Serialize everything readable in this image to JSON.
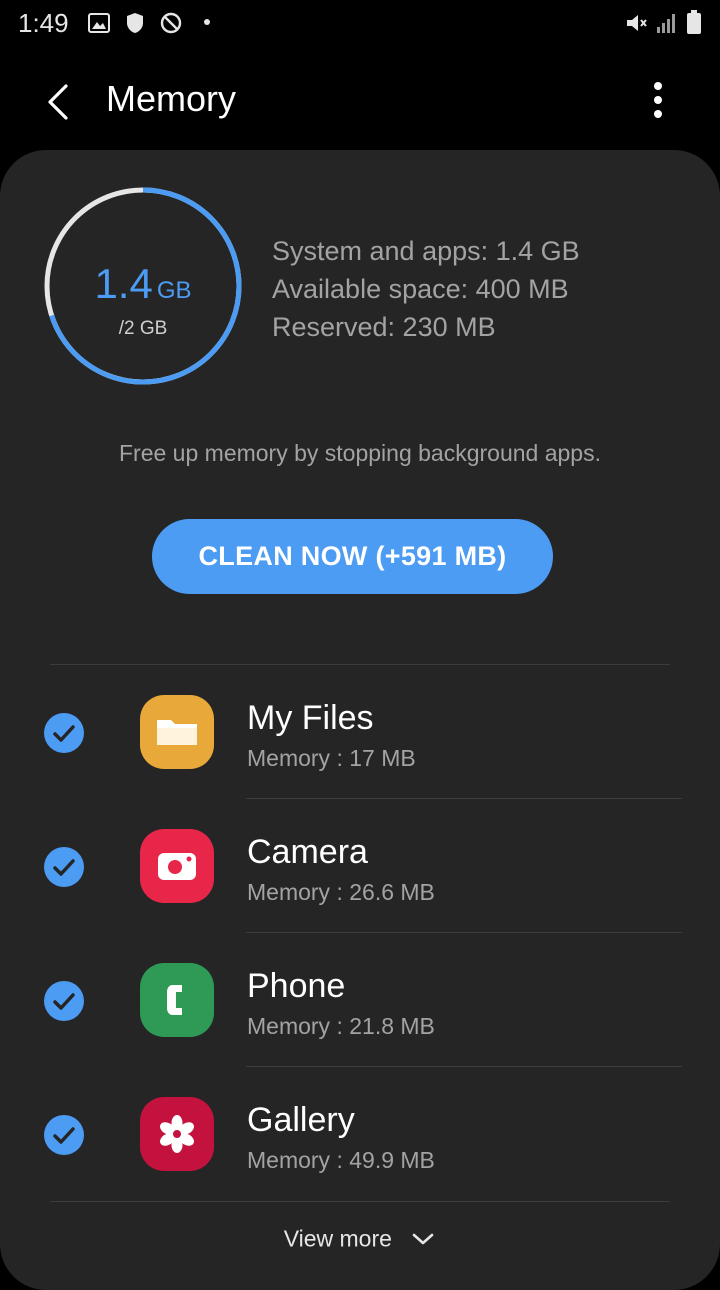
{
  "status_bar": {
    "time": "1:49",
    "left_icons": [
      "image-icon",
      "shield-icon",
      "no-sync-icon",
      "dot-icon"
    ],
    "right_icons": [
      "vibrate-mute-icon",
      "signal-icon",
      "battery-icon"
    ]
  },
  "app_bar": {
    "title": "Memory",
    "back_icon": "back-arrow-icon",
    "more_icon": "more-vert-icon"
  },
  "memory_gauge": {
    "used_value": "1.4",
    "used_unit": "GB",
    "total": "/2 GB",
    "used_fraction": 0.7,
    "accent": "#4d9cf4",
    "track": "#e6e6e6"
  },
  "stats": {
    "system_and_apps": "System and apps: 1.4 GB",
    "available": "Available space: 400 MB",
    "reserved": "Reserved: 230 MB"
  },
  "hint": "Free up memory by stopping background apps.",
  "clean_button": "CLEAN NOW (+591 MB)",
  "apps": [
    {
      "name": "My Files",
      "memory": "Memory : 17 MB",
      "icon": "folder-icon",
      "color": "#e9a83a",
      "checked": true
    },
    {
      "name": "Camera",
      "memory": "Memory : 26.6 MB",
      "icon": "camera-icon",
      "color": "#e8264a",
      "checked": true
    },
    {
      "name": "Phone",
      "memory": "Memory : 21.8 MB",
      "icon": "phone-icon",
      "color": "#2f9a55",
      "checked": true
    },
    {
      "name": "Gallery",
      "memory": "Memory : 49.9 MB",
      "icon": "flower-icon",
      "color": "#c3123e",
      "checked": true
    }
  ],
  "view_more": "View more"
}
